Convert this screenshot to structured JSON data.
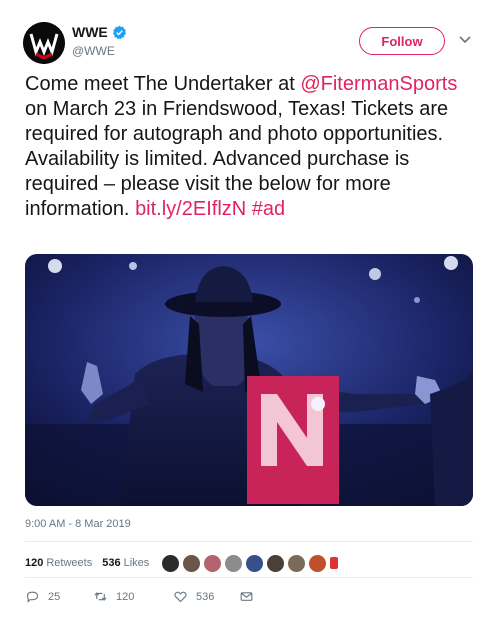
{
  "account": {
    "name": "WWE",
    "handle": "@WWE",
    "verified_icon": "verified-badge-icon",
    "accent_color": "#e0245e"
  },
  "follow_button": {
    "label": "Follow"
  },
  "tweet": {
    "text_part1": "Come meet The Undertaker at ",
    "mention": "@FitermanSports",
    "text_part2": " on March 23 in Friendswood, Texas! Tickets are required for autograph and photo opportunities. Availability is limited. Advanced purchase is required – please visit the below for more information. ",
    "link": "bit.ly/2EIflzN",
    "hashtag": "#ad",
    "timestamp": "9:00 AM - 8 Mar 2019"
  },
  "stats": {
    "retweets_count": "120",
    "retweets_label": "Retweets",
    "likes_count": "536",
    "likes_label": "Likes"
  },
  "actions": {
    "reply_count": "25",
    "retweet_count": "120",
    "like_count": "536"
  }
}
